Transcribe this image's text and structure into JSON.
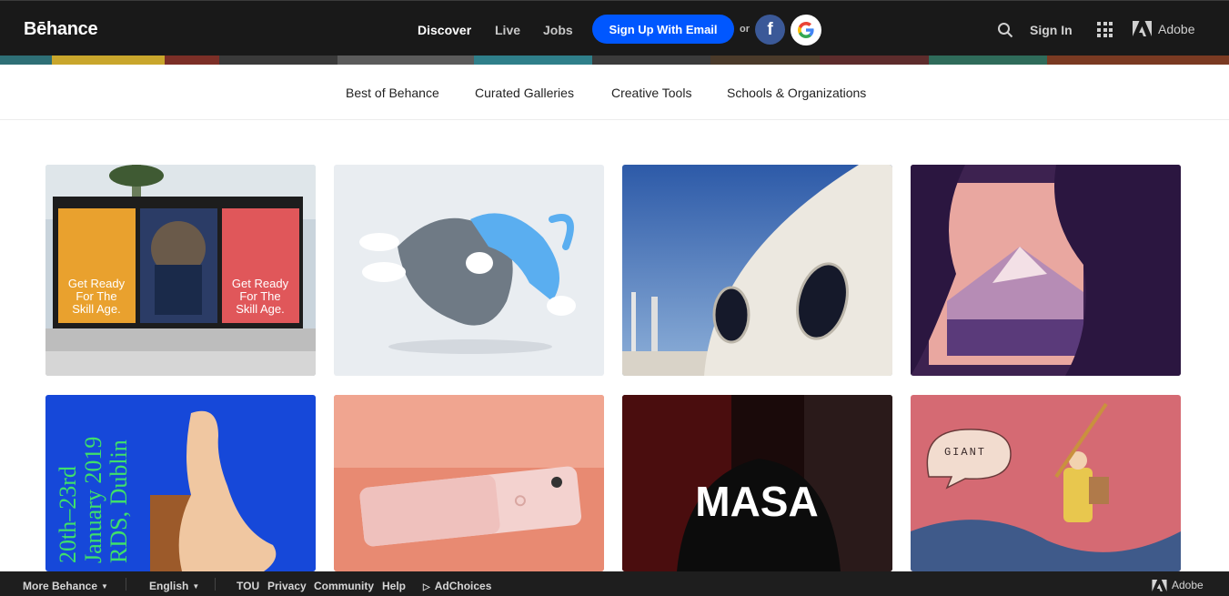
{
  "header": {
    "logo": "Bēhance",
    "nav": {
      "discover": "Discover",
      "live": "Live",
      "jobs": "Jobs"
    },
    "signup_label": "Sign Up With Email",
    "or_label": "or",
    "facebook_glyph": "f",
    "signin_label": "Sign In",
    "adobe_label": "Adobe",
    "icons": [
      "search-icon",
      "apps-grid-icon",
      "adobe-logo-icon",
      "facebook-icon",
      "google-icon"
    ]
  },
  "subnav": {
    "items": [
      "Best of Behance",
      "Curated Galleries",
      "Creative Tools",
      "Schools & Organizations"
    ]
  },
  "projects": {
    "tiles": [
      {
        "poster_left": "Get Ready For The Skill Age.",
        "poster_right": "Get Ready For The Skill Age."
      },
      {},
      {},
      {},
      {
        "poster_text": "20th–23rd January 2019 RDS, Dublin"
      },
      {},
      {
        "title": "MASA"
      },
      {
        "speech_bubble": "GIANT"
      }
    ]
  },
  "footer": {
    "more_behance": "More Behance",
    "language": "English",
    "tou": "TOU",
    "privacy": "Privacy",
    "community": "Community",
    "help": "Help",
    "adchoices": "AdChoices",
    "adobe_label": "Adobe"
  },
  "colors": {
    "header_bg": "#191919",
    "signup_blue": "#0057ff",
    "facebook_blue": "#3b5998",
    "footer_bg": "#1e1e1e"
  }
}
